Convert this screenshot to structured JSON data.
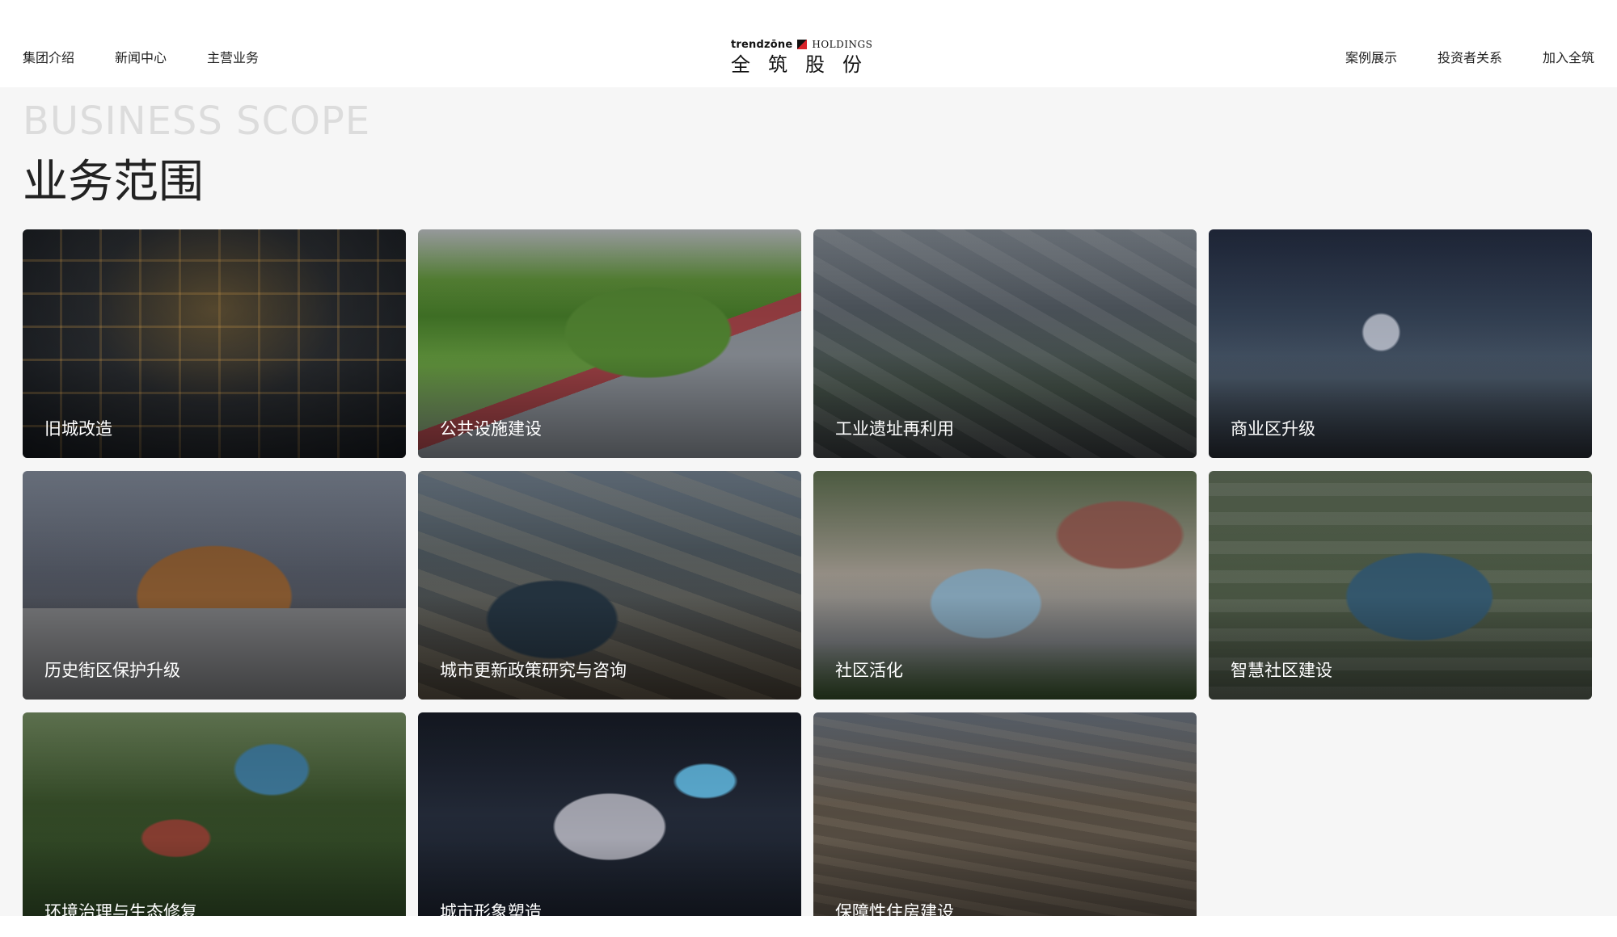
{
  "header": {
    "nav_left": [
      "集团介绍",
      "新闻中心",
      "主营业务"
    ],
    "nav_right": [
      "案例展示",
      "投资者关系",
      "加入全筑"
    ],
    "logo": {
      "brand": "trendzōne",
      "holdings": "HOLDINGS",
      "cn": "全筑股份",
      "accent_color": "#d8232a"
    }
  },
  "section": {
    "title_en": "BUSINESS SCOPE",
    "title_cn": "业务范围"
  },
  "business_cards": [
    {
      "label": "旧城改造"
    },
    {
      "label": "公共设施建设"
    },
    {
      "label": "工业遗址再利用"
    },
    {
      "label": "商业区升级"
    },
    {
      "label": "历史街区保护升级"
    },
    {
      "label": "城市更新政策研究与咨询"
    },
    {
      "label": "社区活化"
    },
    {
      "label": "智慧社区建设"
    },
    {
      "label": "环境治理与生态修复"
    },
    {
      "label": "城市形象塑造"
    },
    {
      "label": "保障性住房建设"
    }
  ]
}
